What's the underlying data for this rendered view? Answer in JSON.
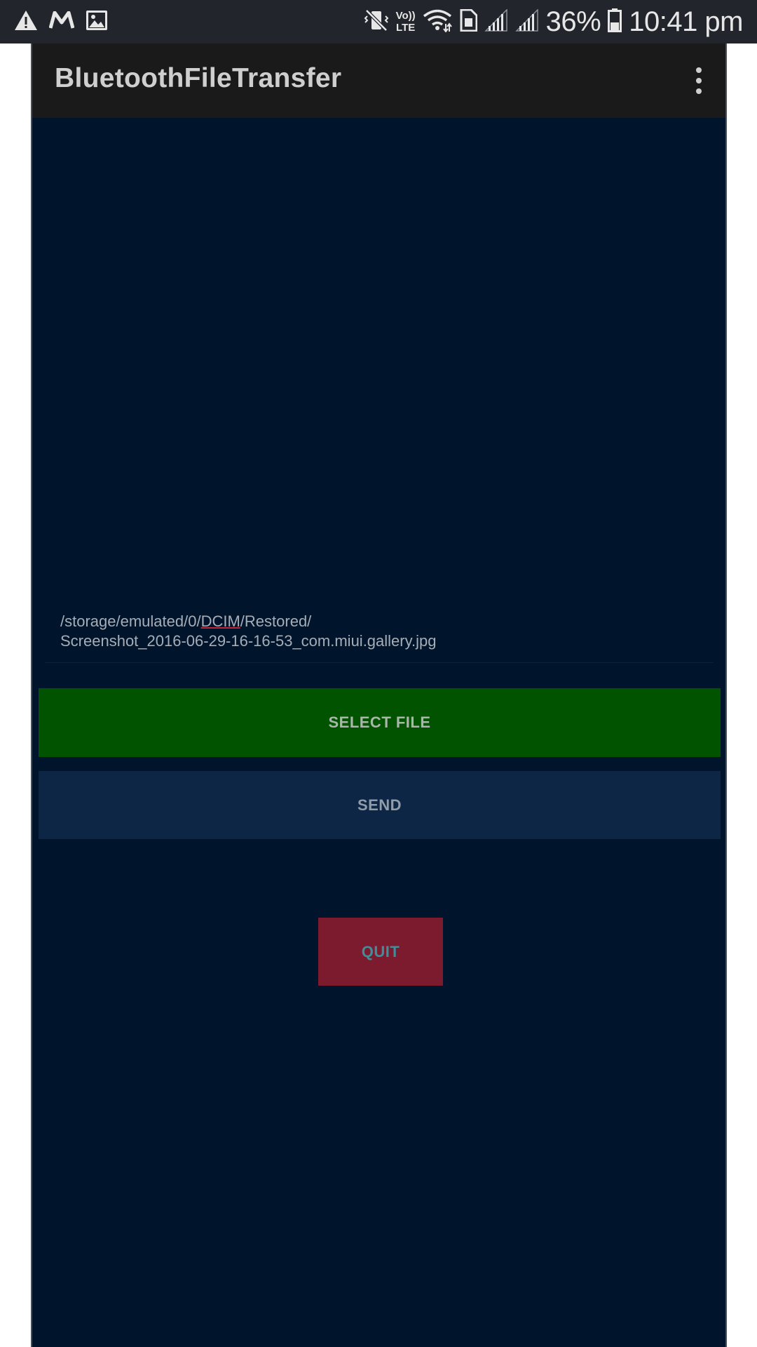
{
  "status_bar": {
    "left_icons": [
      "warning-icon",
      "m-app-icon",
      "gallery-icon"
    ],
    "right_icons": [
      "mute-vibrate-icon",
      "volte-icon",
      "wifi-icon",
      "sim-icon",
      "signal-icon",
      "signal-icon",
      "battery-icon"
    ],
    "volte_top": "Vo))",
    "volte_bottom": "LTE",
    "battery_percent": "36%",
    "time": "10:41 pm"
  },
  "toolbar": {
    "title": "BluetoothFileTransfer",
    "overflow_icon": "more-vert-icon"
  },
  "file_path": {
    "line1_a": "/storage/emulated/0/",
    "line1_b": "DCIM",
    "line1_c": "/Restored/",
    "line2": "Screenshot_2016-06-29-16-16-53_com.miui.gallery.jpg"
  },
  "buttons": {
    "select_file": "SELECT FILE",
    "send": "SEND",
    "quit": "QUIT"
  },
  "colors": {
    "background": "#00152c",
    "toolbar": "#1a1a1a",
    "select_file_bg": "#025300",
    "send_bg": "#0d2645",
    "quit_bg": "#7c1a2e"
  }
}
